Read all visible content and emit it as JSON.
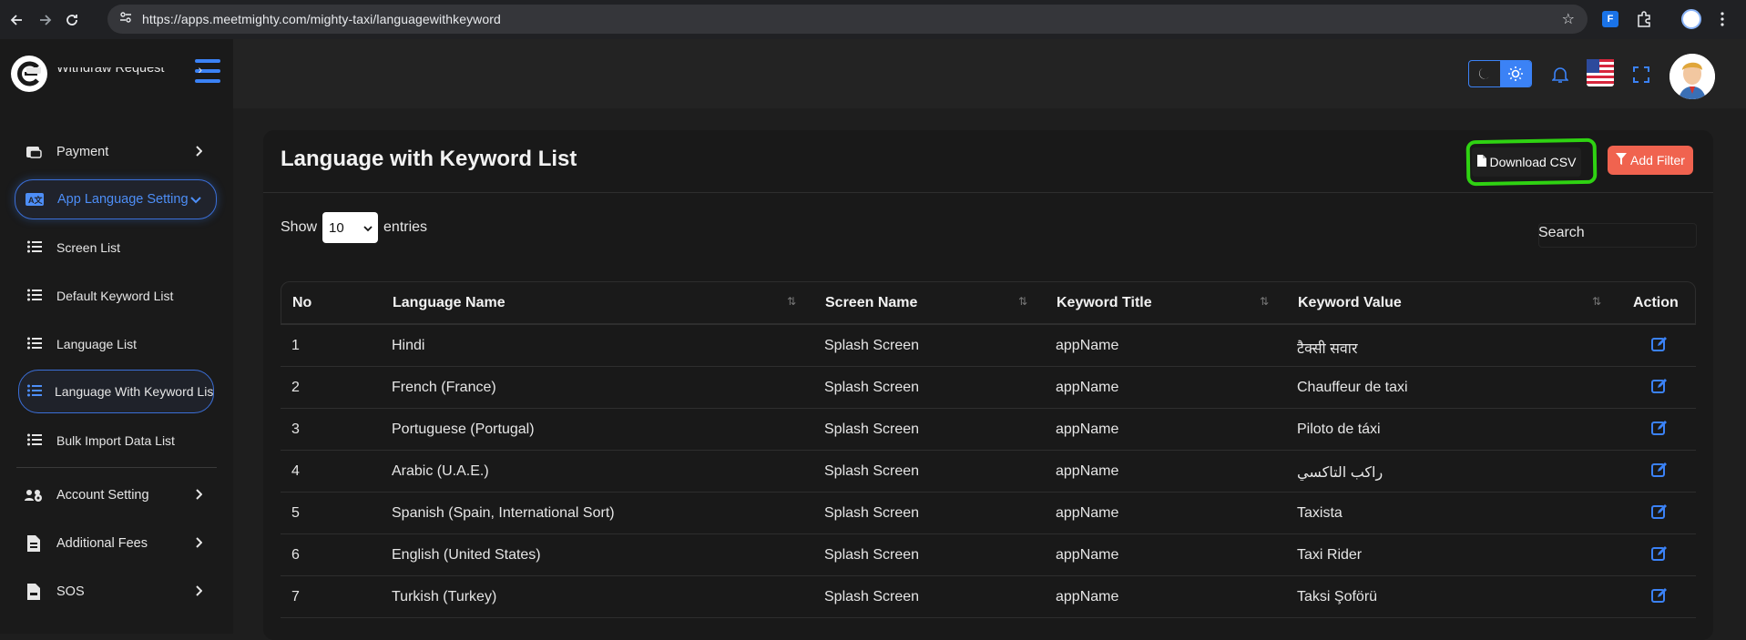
{
  "browser": {
    "url": "https://apps.meetmighty.com/mighty-taxi/languagewithkeyword"
  },
  "sidebar": {
    "items": [
      {
        "label": "Withdraw Request",
        "icon": "wallet-icon"
      },
      {
        "label": "Payment",
        "icon": "payment-icon"
      },
      {
        "label": "App Language Setting",
        "icon": "language-icon"
      },
      {
        "label": "Account Setting",
        "icon": "users-gear-icon"
      },
      {
        "label": "Additional Fees",
        "icon": "file-invoice-icon"
      },
      {
        "label": "SOS",
        "icon": "sos-icon"
      }
    ],
    "sub_items": [
      {
        "label": "Screen List"
      },
      {
        "label": "Default Keyword List"
      },
      {
        "label": "Language List"
      },
      {
        "label": "Language With Keyword List"
      },
      {
        "label": "Bulk Import Data List"
      }
    ]
  },
  "page": {
    "title": "Language with Keyword List",
    "download_label": "Download CSV",
    "filter_label": "Add Filter",
    "show_label": "Show",
    "entries_label": "entries",
    "entries_value": "10",
    "search_label": "Search"
  },
  "table": {
    "headers": [
      "No",
      "Language Name",
      "Screen Name",
      "Keyword Title",
      "Keyword Value",
      "Action"
    ],
    "rows": [
      {
        "no": "1",
        "language": "Hindi",
        "screen": "Splash Screen",
        "title": "appName",
        "value": "टैक्सी सवार"
      },
      {
        "no": "2",
        "language": "French (France)",
        "screen": "Splash Screen",
        "title": "appName",
        "value": "Chauffeur de taxi"
      },
      {
        "no": "3",
        "language": "Portuguese (Portugal)",
        "screen": "Splash Screen",
        "title": "appName",
        "value": "Piloto de táxi"
      },
      {
        "no": "4",
        "language": "Arabic (U.A.E.)",
        "screen": "Splash Screen",
        "title": "appName",
        "value": "راكب التاكسي"
      },
      {
        "no": "5",
        "language": "Spanish (Spain, International Sort)",
        "screen": "Splash Screen",
        "title": "appName",
        "value": "Taxista"
      },
      {
        "no": "6",
        "language": "English (United States)",
        "screen": "Splash Screen",
        "title": "appName",
        "value": "Taxi Rider"
      },
      {
        "no": "7",
        "language": "Turkish (Turkey)",
        "screen": "Splash Screen",
        "title": "appName",
        "value": "Taksi Şoförü"
      }
    ]
  },
  "colors": {
    "accent": "#3b82f6",
    "filter_button": "#f0634f",
    "highlight": "#2fd212"
  }
}
